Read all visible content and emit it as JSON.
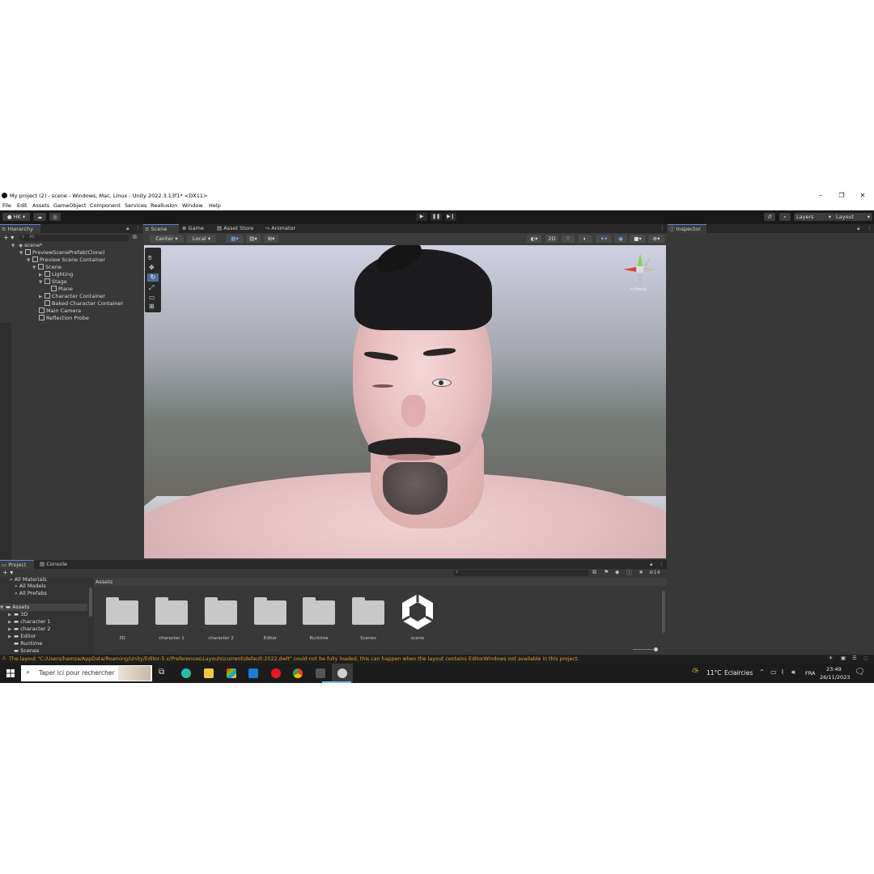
{
  "window": {
    "title": "My project (2) - scene - Windows, Mac, Linux - Unity 2022.3.13f1* <DX11>",
    "minimize": "–",
    "restore": "❐",
    "close": "✕"
  },
  "menu": [
    "File",
    "Edit",
    "Assets",
    "GameObject",
    "Component",
    "Services",
    "Reallusion",
    "Window",
    "Help"
  ],
  "toolbar": {
    "account": "HK",
    "layers": "Layers",
    "layout": "Layout",
    "play": "▶",
    "pause": "❚❚",
    "step": "▶❙"
  },
  "hierarchy": {
    "tab": "Hierarchy",
    "search_placeholder": "All",
    "scene_name": "scene*",
    "items": [
      "PreviewScenePrefab(Clone)",
      "Preview Scene Container",
      "Scene",
      "Lighting",
      "Stage",
      "Plane",
      "Character Container",
      "Baked Character Container",
      "Main Camera",
      "Reflection Probe"
    ]
  },
  "scene_tabs": [
    "Scene",
    "Game",
    "Asset Store",
    "Animator"
  ],
  "scene_toolbar": {
    "pivot": "Center",
    "space": "Local",
    "mode_2d": "2D"
  },
  "gizmo": {
    "label": "< Persp"
  },
  "inspector": {
    "tab": "Inspector"
  },
  "project": {
    "tabs": [
      "Project",
      "Console"
    ],
    "favorites": [
      "All Materials",
      "All Models",
      "All Prefabs"
    ],
    "assets_root": "Assets",
    "tree": [
      "3D",
      "character 1",
      "character 2",
      "Editor",
      "Runtime",
      "Scenes"
    ],
    "breadcrumb": "Assets",
    "hidden_count": "14",
    "grid": [
      "3D",
      "character 1",
      "character 2",
      "Editor",
      "Runtime",
      "Scenes",
      "scene"
    ]
  },
  "status": {
    "message": "The layout \"C:/Users/hamza/AppData/Roaming/Unity/Editor-5.x/Preferences\\Layouts\\current\\default-2022.dwlt\" could not be fully loaded, this can happen when the layout contains EditorWindows not available in this project."
  },
  "taskbar": {
    "search_placeholder": "Taper ici pour rechercher",
    "weather_temp": "11°C",
    "weather_desc": "Eclaircies",
    "language": "FRA",
    "time": "23:49",
    "date": "26/11/2023"
  },
  "colors": {
    "accent": "#4d8ed8",
    "warning": "#e0a020",
    "editor_bg": "#383838"
  }
}
